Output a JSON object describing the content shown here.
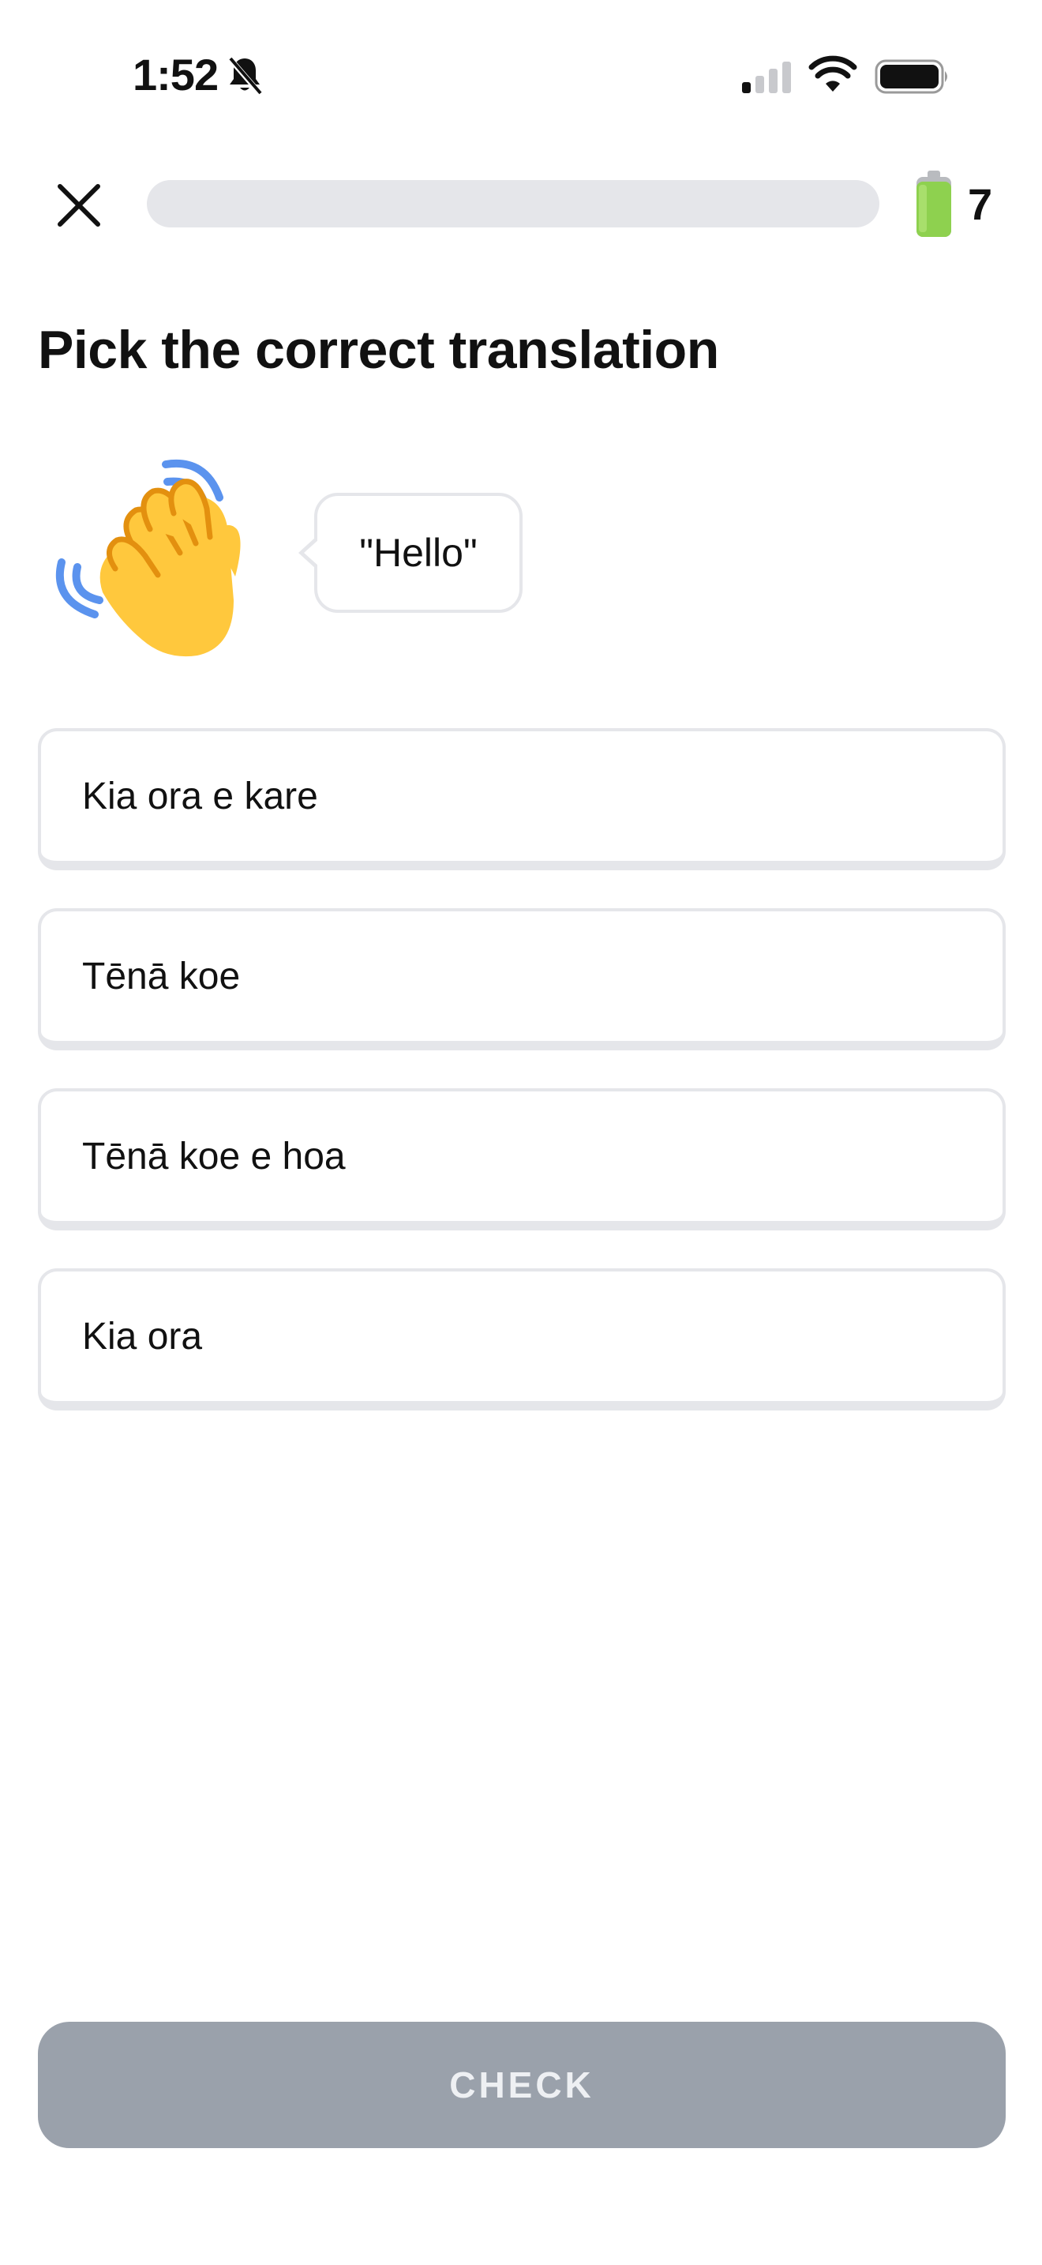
{
  "status_bar": {
    "time": "1:52",
    "icons": [
      "bell-slash-icon",
      "cellular-signal-icon",
      "wifi-icon",
      "battery-icon"
    ]
  },
  "header": {
    "close_icon": "close-icon",
    "progress_fraction": 0,
    "energy_icon": "battery-energy-icon",
    "energy_count": "7"
  },
  "main": {
    "title": "Pick the correct translation",
    "prompt_icon": "waving-hand-icon",
    "prompt_text": "\"Hello\"",
    "options": [
      {
        "label": "Kia ora e kare"
      },
      {
        "label": "Tēnā koe"
      },
      {
        "label": "Tēnā koe e hoa"
      },
      {
        "label": "Kia ora"
      }
    ]
  },
  "footer": {
    "check_label": "CHECK"
  },
  "colors": {
    "option_border": "#e5e6ea",
    "progress_track": "#e5e6ea",
    "check_button": "#9aa1ab",
    "energy_green": "#8ed14f",
    "wave_blue": "#5b93ee",
    "hand_yellow": "#ffc83d"
  }
}
